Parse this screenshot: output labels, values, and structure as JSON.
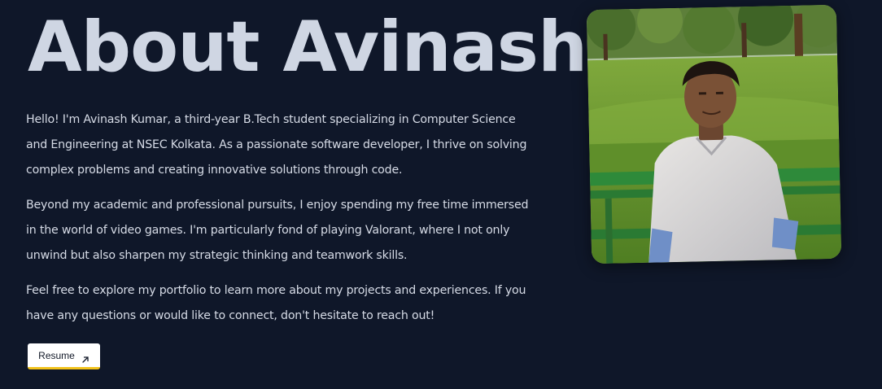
{
  "about": {
    "title": "About Avinash",
    "paragraphs": [
      "Hello! I'm Avinash Kumar, a third-year B.Tech student specializing in Computer Science and Engineering at NSEC Kolkata. As a passionate software developer, I thrive on solving complex problems and creating innovative solutions through code.",
      "Beyond my academic and professional pursuits, I enjoy spending my free time immersed in the world of video games. I'm particularly fond of playing Valorant, where I not only unwind but also sharpen my strategic thinking and teamwork skills.",
      "Feel free to explore my portfolio to learn more about my projects and experiences. If you have any questions or would like to connect, don't hesitate to reach out!"
    ],
    "resume_button": {
      "label": "Resume",
      "icon": "arrow-up-right-icon"
    }
  },
  "colors": {
    "background": "#0f1729",
    "title": "#cfd6e3",
    "text": "#d6dbe6",
    "button_bg": "#ffffff",
    "button_accent": "#f2c21b"
  },
  "photo": {
    "subject": "profile-photo"
  }
}
